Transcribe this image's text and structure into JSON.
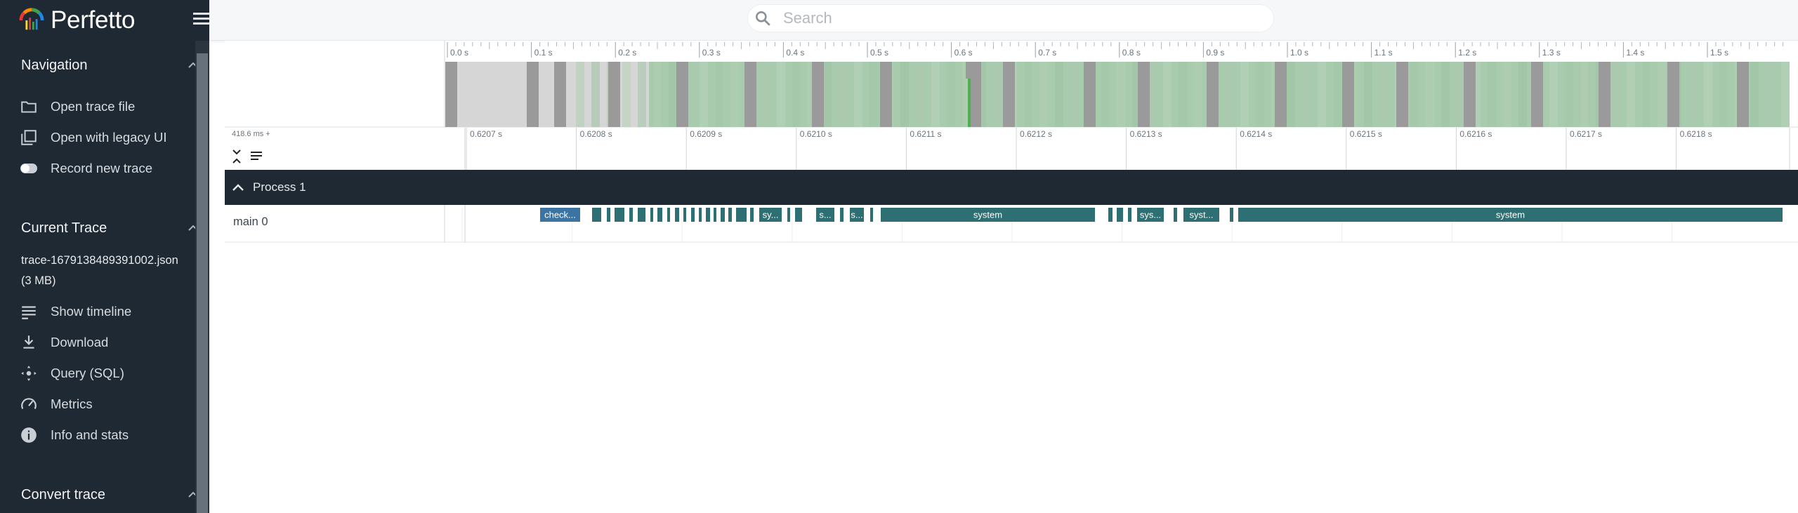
{
  "app": {
    "title": "Perfetto",
    "brand_colors": [
      "#e53935",
      "#fb8c00",
      "#fdd835",
      "#43a047",
      "#1e88e5"
    ]
  },
  "search": {
    "placeholder": "Search",
    "value": ""
  },
  "sidebar": {
    "navigation": {
      "title": "Navigation",
      "items": [
        {
          "label": "Open trace file",
          "icon": "folder-icon"
        },
        {
          "label": "Open with legacy UI",
          "icon": "filter-none-icon"
        },
        {
          "label": "Record new trace",
          "icon": "record-toggle-icon"
        }
      ]
    },
    "current_trace": {
      "title": "Current Trace",
      "trace_name": "trace-1679138489391002.json (3 MB)",
      "items": [
        {
          "label": "Show timeline",
          "icon": "timeline-icon"
        },
        {
          "label": "Download",
          "icon": "download-icon"
        },
        {
          "label": "Query (SQL)",
          "icon": "query-icon"
        },
        {
          "label": "Metrics",
          "icon": "speed-icon"
        },
        {
          "label": "Info and stats",
          "icon": "info-icon"
        }
      ]
    },
    "convert_trace": {
      "title": "Convert trace"
    }
  },
  "overview": {
    "ticks": [
      "0.0 s",
      "0.1 s",
      "0.2 s",
      "0.3 s",
      "0.4 s",
      "0.5 s",
      "0.6 s",
      "0.7 s",
      "0.8 s",
      "0.9 s",
      "1.0 s",
      "1.1 s",
      "1.2 s",
      "1.3 s",
      "1.4 s",
      "1.5 s"
    ],
    "colors": {
      "idle": "#d6d6d6",
      "busy": "#a9cbad",
      "marker": "#9a9a9a",
      "cursor": "#4caf50"
    }
  },
  "detail": {
    "offset_label": "418.6 ms +",
    "ticks": [
      "0.6207 s",
      "0.6208 s",
      "0.6209 s",
      "0.6210 s",
      "0.6211 s",
      "0.6212 s",
      "0.6213 s",
      "0.6214 s",
      "0.6215 s",
      "0.6216 s",
      "0.6217 s",
      "0.6218 s"
    ]
  },
  "process": {
    "title": "Process 1"
  },
  "thread": {
    "name": "main 0",
    "slices": [
      {
        "label": "check...",
        "color": "#3b74a3"
      },
      {
        "label": "sy...",
        "color": "#2e6f73"
      },
      {
        "label": "s...",
        "color": "#2e6f73"
      },
      {
        "label": "s...",
        "color": "#2e6f73"
      },
      {
        "label": "system",
        "color": "#2e6f73"
      },
      {
        "label": "sys...",
        "color": "#2e6f73"
      },
      {
        "label": "syst...",
        "color": "#2e6f73"
      },
      {
        "label": "system",
        "color": "#2e6f73"
      }
    ]
  },
  "colors": {
    "sidebar_bg": "#1f2933",
    "slice": "#2e6f73",
    "slice_alt": "#3b74a3"
  }
}
